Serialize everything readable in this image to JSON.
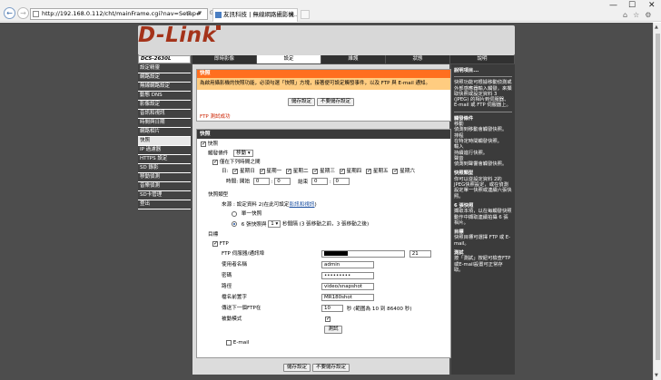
{
  "browser": {
    "url": "http://192.168.0.112/cht/mainFrame.cgi?nav=Setup#",
    "tab_title": "友訊科技 | 無線網路攝影機...",
    "addr_tools": "ρ ▾ ⊙"
  },
  "logo": "D-Link",
  "model": "DCS-2630L",
  "topnav": [
    "即時影像",
    "設定",
    "維護",
    "狀態",
    "說明"
  ],
  "topnav_active": 1,
  "sidebar": {
    "items": [
      "設定精靈",
      "網路設定",
      "無線網路設定",
      "動態 DNS",
      "影像設定",
      "音訊和視訊",
      "時間與日期",
      "網路相片",
      "快照",
      "IP 過濾器",
      "HTTPS 設定",
      "SD 錄影",
      "移動偵測",
      "音樂偵測",
      "SD卡管理",
      "登出"
    ],
    "active": 8
  },
  "top_box": {
    "title": "快照",
    "description": "為啟用攝影機的快照功能，必須勾選「快照」方塊，接著便可設定觸發事件，以及 FTP 與 E-mail 通知。",
    "save": "儲存設定",
    "dont_save": "不要儲存設定",
    "status": "FTP 測試成功"
  },
  "main_box": {
    "title": "快照",
    "enable_label": "快照",
    "trigger_label": "觸發條件",
    "trigger_value": "移動",
    "schedule_label": "僅在下列時間之間",
    "days_label": "日:",
    "days": [
      "星期日",
      "星期一",
      "星期二",
      "星期三",
      "星期四",
      "星期五",
      "星期六"
    ],
    "time_label": "時間: 開始",
    "time_start_h": "0",
    "time_start_m": "0",
    "time_end_label": "結束",
    "time_end_h": "0",
    "time_end_m": "0",
    "colon": ":",
    "type_label": "快照類型",
    "source_text": "來源 : 設定資料 2(在此可設定",
    "source_link": "影訊和視訊",
    "source_close": ")",
    "single_label": "單一快照",
    "burst_prefix": "6 張快照與",
    "burst_value": "1",
    "burst_suffix": "秒間隔 (3 張移動之前，3 張移動之後)",
    "target_label": "目標",
    "ftp_label": "FTP",
    "ftp_server_label": "FTP 伺服器/通訊埠",
    "ftp_port": "21",
    "username_label": "使用者名稱",
    "username": "admin",
    "password_label": "密碼",
    "password": "•••••••••",
    "path_label": "路徑",
    "path": "video/snapshot",
    "prefix_label": "檔名前置字",
    "prefix": "MR180shot",
    "interval_label": "傳送下一個FTP在",
    "interval": "10",
    "interval_hint": "秒 (範圍為 10 到 86400 秒)",
    "passive_label": "被動模式",
    "test_button": "測試",
    "email_label": "E-mail"
  },
  "bottom": {
    "save": "儲存設定",
    "dont_save": "不要儲存設定"
  },
  "help": {
    "title": "說明項目...",
    "intro": "快照功能可根據移動偵測或外部感應器輸入觸發，來擷取快照或設定資料 3 (JPEG) 的相片到伺服器、E-mail 或 FTP 伺服器上。",
    "s1_title": "觸發條件",
    "s1_body": "移動\n偵測到移動會觸發快照。\n排程\n在特定時間觸發快照。\n輸入\n持續進行快照。\n聲音\n偵測到聲響會觸發快照。",
    "s2_title": "快照類型",
    "s2_body": "你可以從設定資料 2的 JPEG快照設定，或在偵測設定單一快照或連續六張快照。",
    "s3_title": "6 張快照",
    "s3_body": "擷取本項，以在每觸發快照動作中擷取連續拍攝 6 張相片。",
    "s4_title": "目標",
    "s4_body": "快照目標可選擇 FTP 或 E-mail。",
    "s5_title": "測試",
    "s5_body": "按「測試」按鈕可檢查FTP或E-mail設置可正常存取。"
  }
}
